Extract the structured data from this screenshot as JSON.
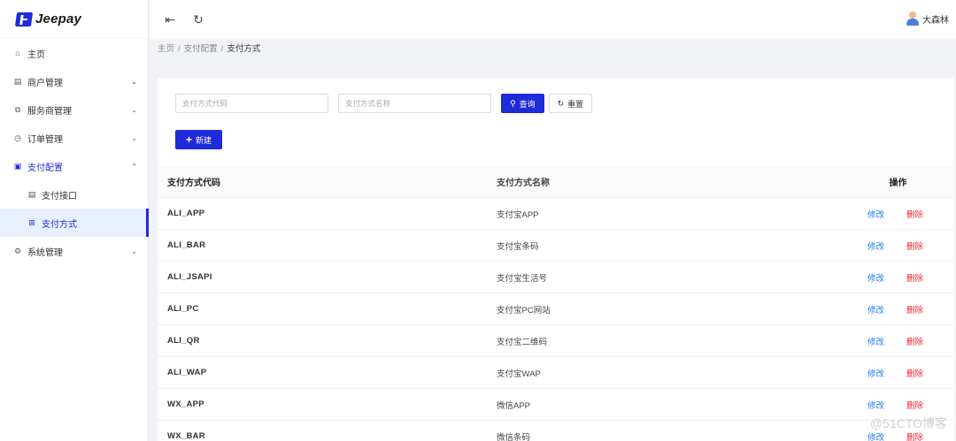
{
  "app": {
    "name": "Jeepay"
  },
  "sidebar": {
    "items": [
      {
        "label": "主页",
        "icon": "home-icon",
        "glyph": "⌂"
      },
      {
        "label": "商户管理",
        "icon": "store-icon",
        "glyph": "▤",
        "arrow": "⌄"
      },
      {
        "label": "服务商管理",
        "icon": "copy-icon",
        "glyph": "⧉",
        "arrow": "⌄"
      },
      {
        "label": "订单管理",
        "icon": "clock-icon",
        "glyph": "◷",
        "arrow": "⌄"
      },
      {
        "label": "支付配置",
        "icon": "file-icon",
        "glyph": "▣",
        "arrow": "⌃"
      },
      {
        "label": "支付接口",
        "icon": "list-icon",
        "glyph": "▤"
      },
      {
        "label": "支付方式",
        "icon": "grid-icon",
        "glyph": "⊞"
      },
      {
        "label": "系统管理",
        "icon": "gear-icon",
        "glyph": "⚙",
        "arrow": "⌄"
      }
    ]
  },
  "header": {
    "menu_fold_glyph": "⇤",
    "reload_glyph": "↻",
    "user_name": "大森林"
  },
  "breadcrumb": {
    "home": "主页",
    "sep": "/",
    "parent": "支付配置",
    "current": "支付方式"
  },
  "search": {
    "code_placeholder": "支付方式代码",
    "name_placeholder": "支付方式名称",
    "query_label": "查询",
    "query_glyph": "⚲",
    "reset_label": "重置",
    "reset_glyph": "↻",
    "new_label": "新建",
    "new_glyph": "+"
  },
  "table": {
    "headers": {
      "code": "支付方式代码",
      "name": "支付方式名称",
      "ops": "操作"
    },
    "edit_label": "修改",
    "delete_label": "删除",
    "rows": [
      {
        "code": "ALI_APP",
        "name": "支付宝APP"
      },
      {
        "code": "ALI_BAR",
        "name": "支付宝条码"
      },
      {
        "code": "ALI_JSAPI",
        "name": "支付宝生活号"
      },
      {
        "code": "ALI_PC",
        "name": "支付宝PC网站"
      },
      {
        "code": "ALI_QR",
        "name": "支付宝二维码"
      },
      {
        "code": "ALI_WAP",
        "name": "支付宝WAP"
      },
      {
        "code": "WX_APP",
        "name": "微信APP"
      },
      {
        "code": "WX_BAR",
        "name": "微信条码"
      }
    ]
  },
  "watermark": "@51CTO博客",
  "colors": {
    "accent": "#1e2bd9",
    "link": "#1e7bff",
    "danger": "#f5222d"
  }
}
